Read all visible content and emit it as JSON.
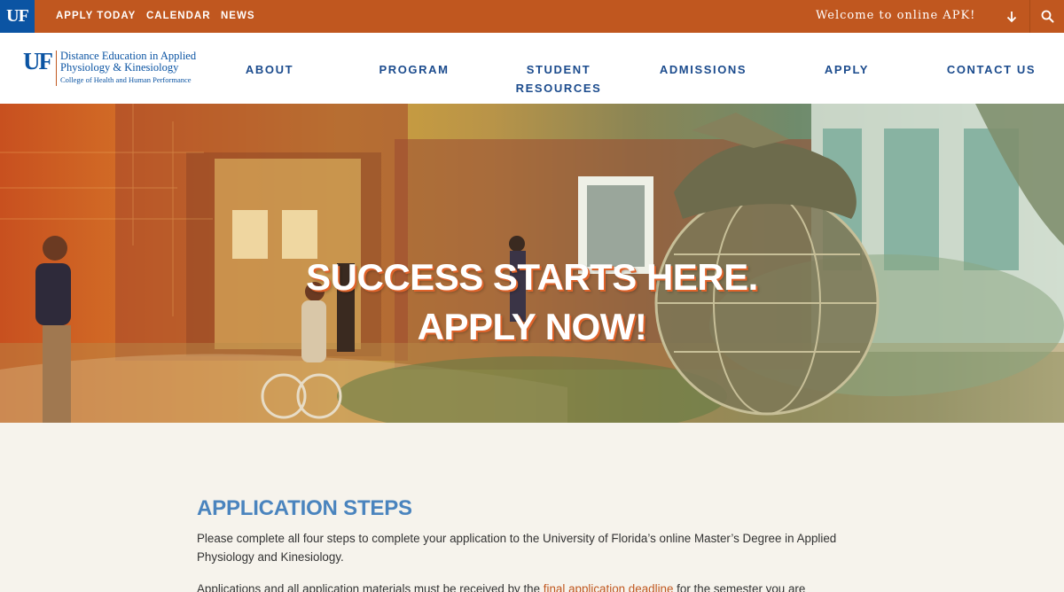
{
  "topbar": {
    "logo": "UF",
    "links": [
      "APPLY TODAY",
      "CALENDAR",
      "NEWS"
    ],
    "welcome": "Welcome to online APK!",
    "down_icon": "arrow-down-icon",
    "search_icon": "search-icon",
    "color": "#c0571f"
  },
  "header": {
    "logo": {
      "mark": "UF",
      "line1": "Distance Education in Applied",
      "line2": "Physiology & Kinesiology",
      "line3": "College of Health and Human Performance"
    },
    "nav": [
      {
        "line1": "ABOUT",
        "line2": ""
      },
      {
        "line1": "PROGRAM",
        "line2": ""
      },
      {
        "line1": "STUDENT",
        "line2": "RESOURCES"
      },
      {
        "line1": "ADMISSIONS",
        "line2": ""
      },
      {
        "line1": "APPLY",
        "line2": ""
      },
      {
        "line1": "CONTACT US",
        "line2": ""
      }
    ]
  },
  "hero": {
    "line1": "SUCCESS STARTS HERE.",
    "line2": "APPLY NOW!"
  },
  "main": {
    "title": "APPLICATION STEPS",
    "para1": "Please complete all four steps to complete your application to the University of Florida’s online Master’s Degree in Applied Physiology and Kinesiology.",
    "para2_before": "Applications and all application materials must be received by the ",
    "para2_link": "final application deadline",
    "para2_after": " for the semester you are"
  },
  "colors": {
    "brand_blue": "#0b54a3",
    "brand_orange": "#c0571f",
    "nav_blue": "#1b4b8d",
    "title_blue": "#4a84be"
  }
}
